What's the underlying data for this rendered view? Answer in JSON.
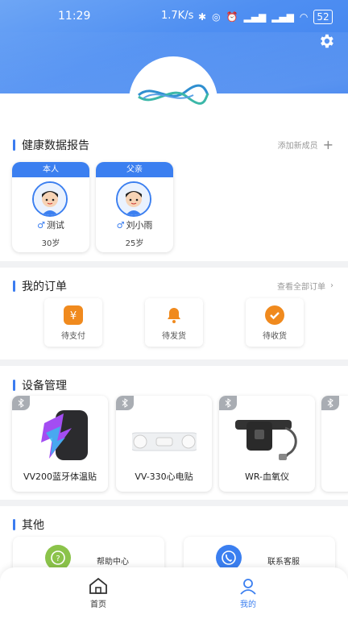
{
  "status_bar": {
    "time": "11:29",
    "speed": "1.7K/s",
    "battery": "52"
  },
  "health": {
    "title": "健康数据报告",
    "add_label": "添加新成员",
    "members": [
      {
        "tag": "本人",
        "name": "测试",
        "age": "30岁"
      },
      {
        "tag": "父亲",
        "name": "刘小雨",
        "age": "25岁"
      }
    ]
  },
  "orders": {
    "title": "我的订单",
    "view_all": "查看全部订单",
    "items": [
      {
        "label": "待支付",
        "icon": "yen-icon"
      },
      {
        "label": "待发货",
        "icon": "bell-icon"
      },
      {
        "label": "待收货",
        "icon": "check-icon"
      }
    ]
  },
  "devices": {
    "title": "设备管理",
    "items": [
      {
        "name": "VV200蓝牙体温贴"
      },
      {
        "name": "VV-330心电贴"
      },
      {
        "name": "WR-血氧仪"
      }
    ]
  },
  "others": {
    "title": "其他",
    "items": [
      {
        "label": "帮助中心",
        "icon": "question-icon",
        "color": "#8bc34a"
      },
      {
        "label": "联系客服",
        "icon": "phone-icon",
        "color": "#3b7ff0"
      }
    ]
  },
  "tabbar": {
    "home": "首页",
    "mine": "我的",
    "active_color": "#3b7ff0"
  }
}
